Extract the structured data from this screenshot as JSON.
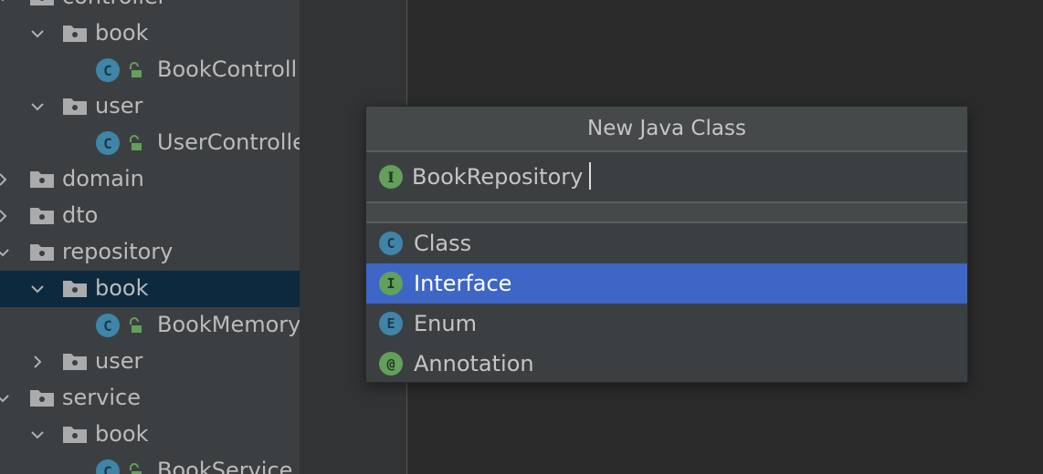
{
  "project_tree": {
    "items": [
      {
        "label": "controller",
        "kind": "package",
        "depth": 0,
        "state": "expanded"
      },
      {
        "label": "book",
        "kind": "package",
        "depth": 1,
        "state": "expanded"
      },
      {
        "label": "BookControll",
        "kind": "class",
        "depth": 2
      },
      {
        "label": "user",
        "kind": "package",
        "depth": 1,
        "state": "expanded"
      },
      {
        "label": "UserControlle",
        "kind": "class",
        "depth": 2
      },
      {
        "label": "domain",
        "kind": "package",
        "depth": 0,
        "state": "collapsed"
      },
      {
        "label": "dto",
        "kind": "package",
        "depth": 0,
        "state": "collapsed"
      },
      {
        "label": "repository",
        "kind": "package",
        "depth": 0,
        "state": "expanded"
      },
      {
        "label": "book",
        "kind": "package",
        "depth": 1,
        "state": "expanded",
        "selected": true
      },
      {
        "label": "BookMemory",
        "kind": "class",
        "depth": 2
      },
      {
        "label": "user",
        "kind": "package",
        "depth": 1,
        "state": "collapsed"
      },
      {
        "label": "service",
        "kind": "package",
        "depth": 0,
        "state": "expanded"
      },
      {
        "label": "book",
        "kind": "package",
        "depth": 1,
        "state": "expanded"
      },
      {
        "label": "BookService",
        "kind": "class",
        "depth": 2
      }
    ],
    "class_badge_letter": "C"
  },
  "dialog": {
    "title": "New Java Class",
    "name_input": {
      "value": "BookRepository",
      "badge_letter": "I"
    },
    "kinds": [
      {
        "label": "Class",
        "badge": "C",
        "badge_color": "#3f85a8",
        "badge_text_color": "#1e3a4a",
        "selected": false
      },
      {
        "label": "Interface",
        "badge": "I",
        "badge_color": "#62a05b",
        "badge_text_color": "#1f3a1e",
        "selected": true
      },
      {
        "label": "Enum",
        "badge": "E",
        "badge_color": "#3f85a8",
        "badge_text_color": "#1e3a4a",
        "selected": false
      },
      {
        "label": "Annotation",
        "badge": "@",
        "badge_color": "#62a05b",
        "badge_text_color": "#1f3a1e",
        "selected": false
      }
    ]
  },
  "colors": {
    "tree_bg": "#3c3f41",
    "selection_tree": "#0d293e",
    "selection_list": "#3e66c7",
    "editor_bg": "#2b2b2b"
  }
}
